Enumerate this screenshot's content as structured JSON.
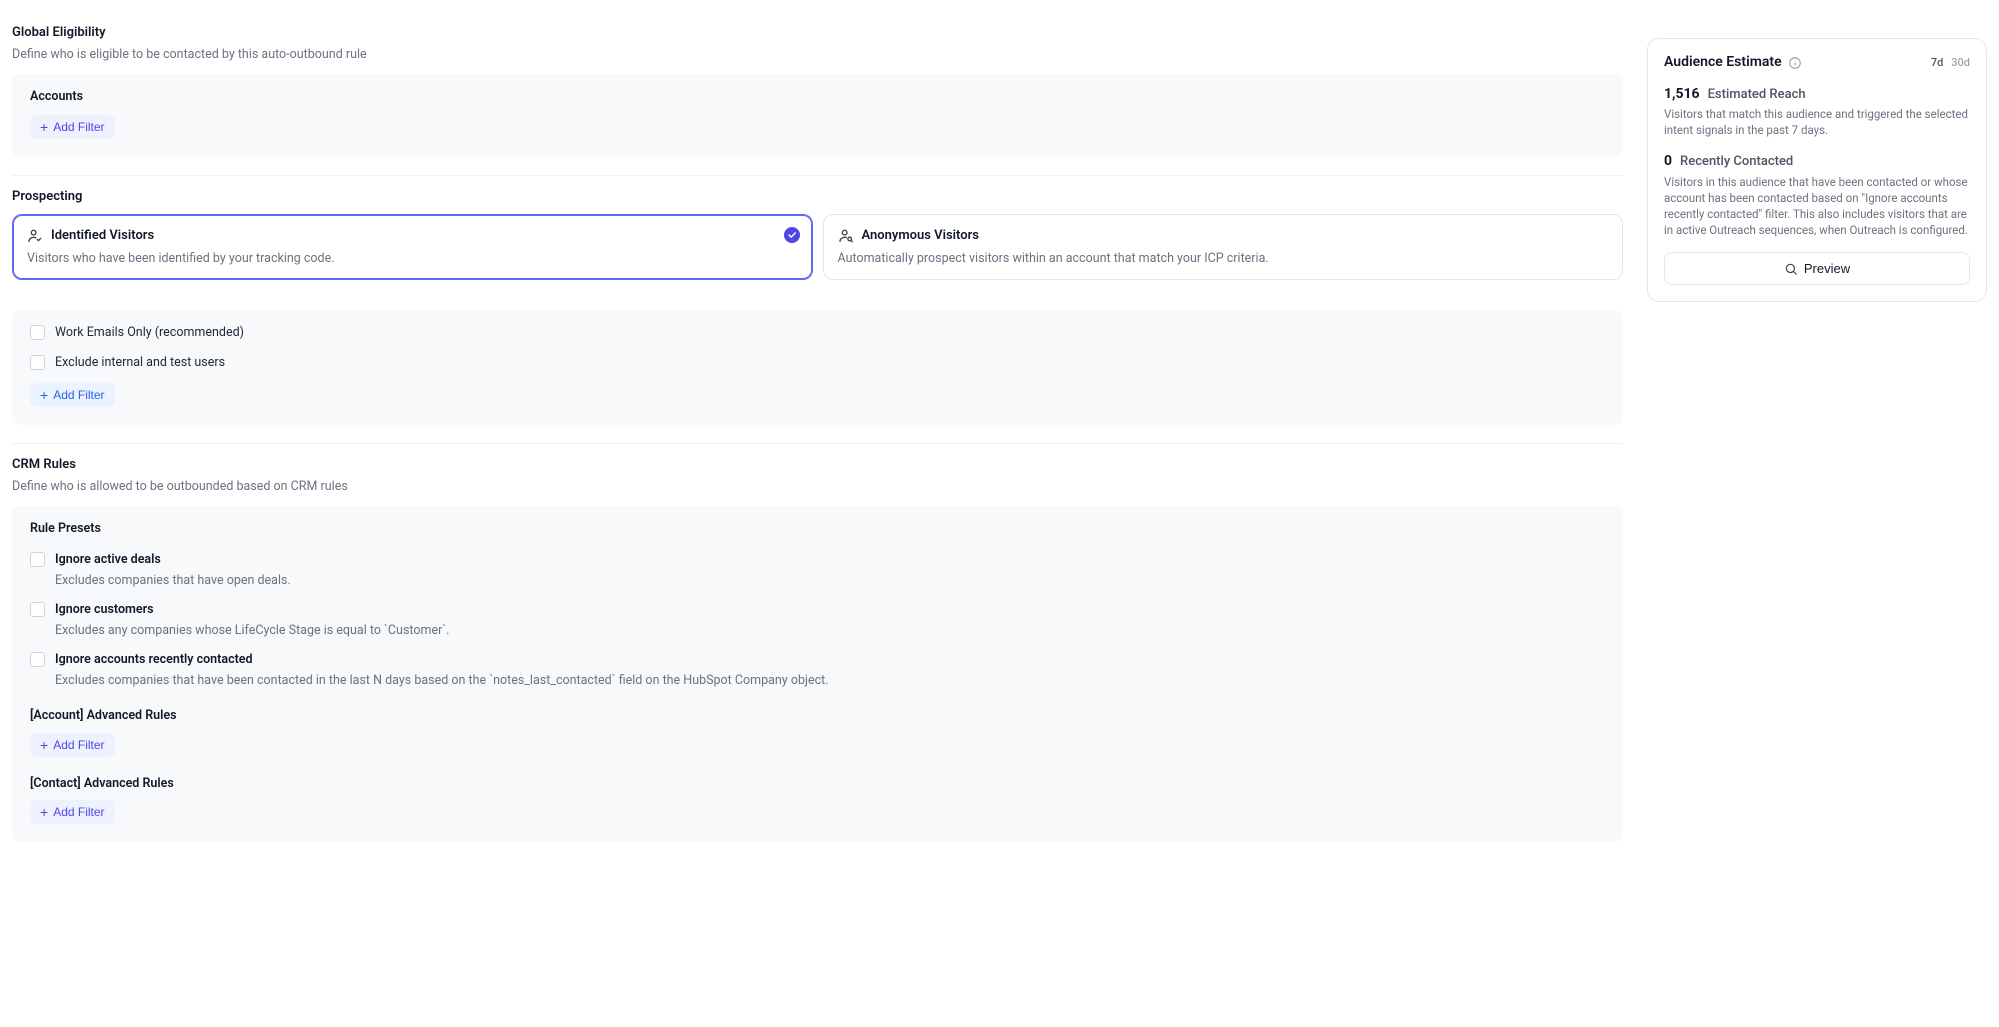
{
  "global": {
    "title": "Global Eligibility",
    "subtitle": "Define who is eligible to be contacted by this auto-outbound rule",
    "accounts_label": "Accounts",
    "add_filter": "Add Filter"
  },
  "prospecting": {
    "title": "Prospecting",
    "identified": {
      "title": "Identified Visitors",
      "desc": "Visitors who have been identified by your tracking code."
    },
    "anonymous": {
      "title": "Anonymous Visitors",
      "desc": "Automatically prospect visitors within an account that match your ICP criteria."
    },
    "options": {
      "work_emails": "Work Emails Only (recommended)",
      "exclude_internal": "Exclude internal and test users",
      "add_filter": "Add Filter"
    }
  },
  "crm": {
    "title": "CRM Rules",
    "subtitle": "Define who is allowed to be outbounded based on CRM rules",
    "presets_label": "Rule Presets",
    "presets": [
      {
        "label": "Ignore active deals",
        "desc": "Excludes companies that have open deals."
      },
      {
        "label": "Ignore customers",
        "desc": "Excludes any companies whose LifeCycle Stage is equal to `Customer`."
      },
      {
        "label": "Ignore accounts recently contacted",
        "desc": "Excludes companies that have been contacted in the last N days based on the `notes_last_contacted` field on the HubSpot Company object."
      }
    ],
    "account_rules_label": "[Account] Advanced Rules",
    "contact_rules_label": "[Contact] Advanced Rules",
    "add_filter": "Add Filter"
  },
  "estimate": {
    "title": "Audience Estimate",
    "range_7d": "7d",
    "range_30d": "30d",
    "reach_number": "1,516",
    "reach_label": "Estimated Reach",
    "reach_desc": "Visitors that match this audience and triggered the selected intent signals in the past 7 days.",
    "recent_number": "0",
    "recent_label": "Recently Contacted",
    "recent_desc": "Visitors in this audience that have been contacted or whose account has been contacted based on \"Ignore accounts recently contacted\" filter. This also includes visitors that are in active Outreach sequences, when Outreach is configured.",
    "preview": "Preview"
  }
}
